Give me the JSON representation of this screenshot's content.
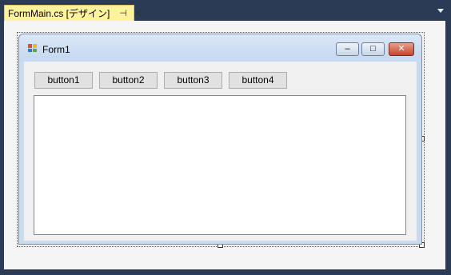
{
  "tab": {
    "label": "FormMain.cs [デザイン]",
    "pin_icon": "pin-icon",
    "close_icon": "close-icon",
    "active_color": "#fff29d"
  },
  "form": {
    "title": "Form1",
    "icon": "windows-form-icon",
    "caption_buttons": [
      "minimize",
      "maximize",
      "close"
    ]
  },
  "buttons": [
    "button1",
    "button2",
    "button3",
    "button4"
  ],
  "colors": {
    "ide_background": "#2b3a55",
    "designer_surface": "#f5f5f5",
    "form_frame": "#c9dbf0",
    "client_area": "#f0f0f0"
  }
}
